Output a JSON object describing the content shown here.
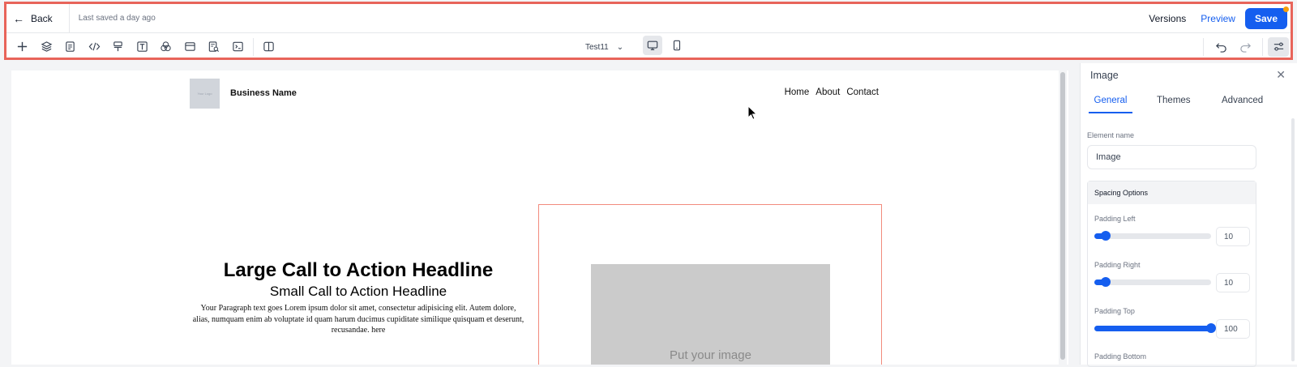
{
  "header": {
    "back_label": "Back",
    "saved_status": "Last saved a day ago",
    "versions_label": "Versions",
    "preview_label": "Preview",
    "save_label": "Save"
  },
  "toolbar": {
    "left_tools": [
      "plus-icon",
      "layers-icon",
      "page-icon",
      "code-icon",
      "paint-format-icon",
      "text-icon",
      "color-circles-icon",
      "section-icon",
      "page-search-icon",
      "terminal-icon",
      "split-view-icon"
    ],
    "page_selector": "Test11",
    "device_modes": [
      "desktop-icon",
      "mobile-icon"
    ],
    "active_device": "desktop",
    "right_tools": [
      "undo-icon",
      "redo-icon",
      "settings-sliders-icon"
    ]
  },
  "canvas": {
    "business_name": "Business Name",
    "logo_text": "Your Logo",
    "nav": [
      "Home",
      "About",
      "Contact"
    ],
    "headline_large": "Large Call to Action Headline",
    "headline_small": "Small Call to Action Headline",
    "paragraph": "Your Paragraph text goes Lorem ipsum dolor sit amet, consectetur adipisicing elit. Autem dolore, alias, numquam enim ab voluptate id quam harum ducimus cupiditate similique quisquam et deserunt, recusandae. here",
    "image_placeholder": "Put your image"
  },
  "panel": {
    "title": "Image",
    "tabs": [
      "General",
      "Themes",
      "Advanced"
    ],
    "active_tab": "General",
    "element_name_label": "Element name",
    "element_name_value": "Image",
    "spacing_title": "Spacing Options",
    "padding": [
      {
        "label": "Padding Left",
        "value": "10",
        "fraction": 0.1
      },
      {
        "label": "Padding Right",
        "value": "10",
        "fraction": 0.1
      },
      {
        "label": "Padding Top",
        "value": "100",
        "fraction": 1.0
      },
      {
        "label": "Padding Bottom",
        "value": "",
        "fraction": null
      }
    ]
  },
  "colors": {
    "accent": "#155eef",
    "highlight_outline": "#e8645a",
    "image_frame": "#f28b7d"
  }
}
